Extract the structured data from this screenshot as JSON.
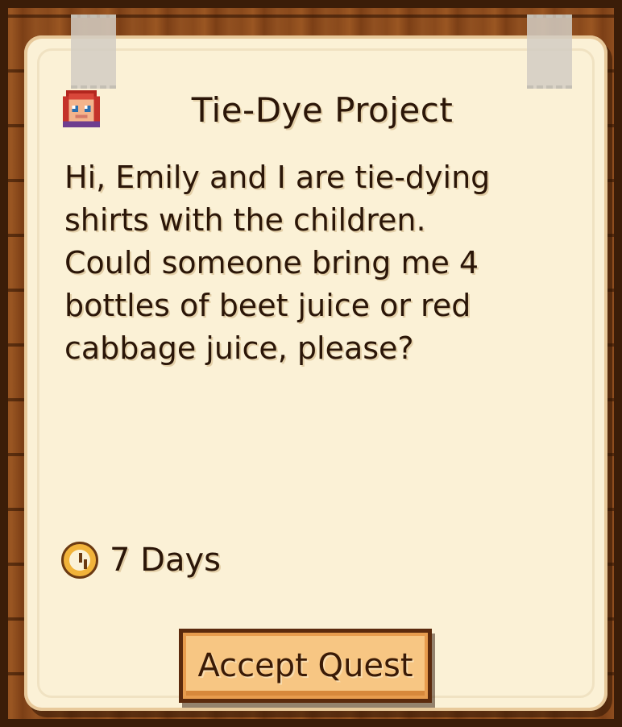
{
  "quest": {
    "title": "Tie-Dye Project",
    "message": "Hi, Emily and I are tie-dying\nshirts with the children.\nCould someone bring me 4\nbottles of beet juice or red\ncabbage juice, please?",
    "portrait_icon": "villager-portrait-icon",
    "duration": "7 Days",
    "duration_icon": "clock-icon",
    "accept_label": "Accept Quest"
  },
  "colors": {
    "paper": "#fbf1d6",
    "text": "#2b1608",
    "button": "#f7c683",
    "wood": "#8a4a1c"
  }
}
